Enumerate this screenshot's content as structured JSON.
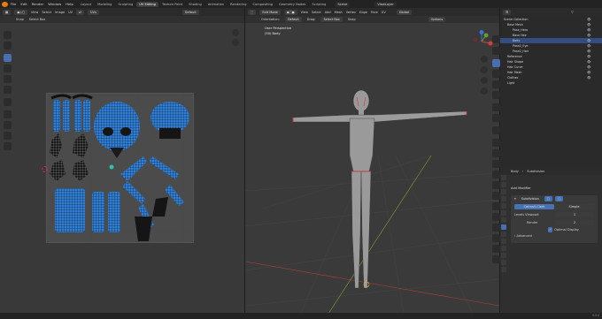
{
  "menubar": {
    "items": [
      "File",
      "Edit",
      "Render",
      "Window",
      "Help"
    ],
    "workspaces": [
      "Layout",
      "Modeling",
      "Sculpting",
      "UV Editing",
      "Texture Paint",
      "Shading",
      "Animation",
      "Rendering",
      "Compositing",
      "Geometry Nodes",
      "Scripting"
    ],
    "active_workspace": "UV Editing",
    "scene": "Scene",
    "view_layer": "ViewLayer"
  },
  "uv_editor": {
    "header": {
      "view": "View",
      "select": "Select",
      "image": "Image",
      "uv": "UV",
      "sync": "UVs",
      "image_name": "Default"
    },
    "sub_header": {
      "snap": "Snap",
      "select_box": "Select Box"
    }
  },
  "viewport": {
    "header": {
      "mode": "Edit Mode",
      "view": "View",
      "select": "Select",
      "add": "Add",
      "mesh": "Mesh",
      "vertex": "Vertex",
      "edge": "Edge",
      "face": "Face",
      "uv": "UV",
      "transform": "Global",
      "options": "Options"
    },
    "sub_header": {
      "orientation_label": "Orientation:",
      "orientation": "Default",
      "drag": "Drag:",
      "select_box": "Select Box",
      "snap": "Snap"
    },
    "overlay_title": "User Perspective",
    "overlay_sub": "(50) Body"
  },
  "outliner": {
    "title": "Scene Collection",
    "rows": [
      {
        "label": "Scene Collection",
        "selected": false
      },
      {
        "label": "Base Mesh",
        "selected": false
      },
      {
        "label": "Pose_Hero",
        "selected": false
      },
      {
        "label": "Base Hair",
        "selected": false
      },
      {
        "label": "Body",
        "selected": true
      },
      {
        "label": "Pose2_Eye",
        "selected": false
      },
      {
        "label": "Pose2_Hair",
        "selected": false
      },
      {
        "label": "Reference",
        "selected": false
      },
      {
        "label": "Hair Shape",
        "selected": false
      },
      {
        "label": "Hair Curve",
        "selected": false
      },
      {
        "label": "Hair Mesh",
        "selected": false
      },
      {
        "label": "Clothes",
        "selected": false
      },
      {
        "label": "Light",
        "selected": false
      }
    ]
  },
  "properties": {
    "breadcrumb_object": "Body",
    "breadcrumb_modifier": "Subdivision",
    "add_modifier": "Add Modifier",
    "modifier_name": "Subdivision",
    "mode_left": "Catmull-Clark",
    "mode_right": "Simple",
    "levels_viewport_label": "Levels Viewport",
    "levels_viewport": "1",
    "render_label": "Render",
    "render": "2",
    "optimal_display": "Optimal Display",
    "advanced": "Advanced"
  },
  "status": {
    "version": "3.3.0"
  }
}
